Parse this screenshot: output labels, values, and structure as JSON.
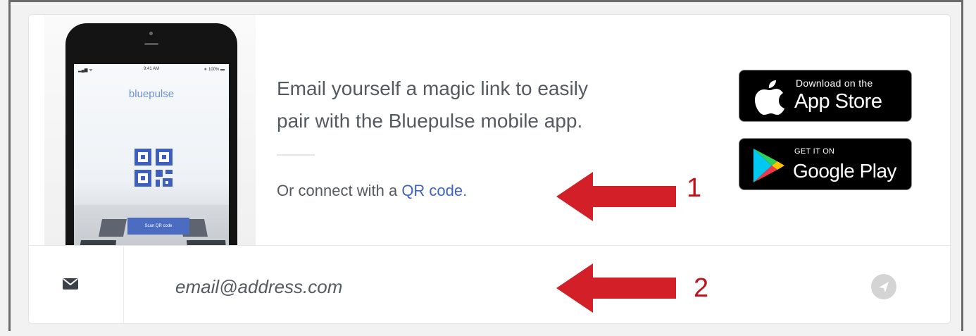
{
  "phone": {
    "status_time": "9:41 AM",
    "status_signal": "▂▄▆ ᯤ",
    "status_battery": "∗ 100% ▬",
    "brand": "bluepulse",
    "scan_button": "Scan QR code"
  },
  "message": {
    "line1": "Email yourself a magic link to easily",
    "line2": "pair with the Bluepulse mobile app."
  },
  "qr": {
    "prefix": "Or connect with a ",
    "link": "QR code."
  },
  "stores": {
    "apple_small": "Download on the",
    "apple_big": "App Store",
    "google_small": "GET IT ON",
    "google_big": "Google Play"
  },
  "email": {
    "placeholder": "email@address.com"
  },
  "annotations": {
    "one": "1",
    "two": "2"
  },
  "icons": {
    "mail": "mail-icon",
    "send": "paper-plane-icon",
    "apple": "apple-icon",
    "play": "google-play-icon"
  },
  "colors": {
    "link": "#3f63bf",
    "annotation": "#c1121b",
    "scan_button": "#4b6cc1"
  }
}
